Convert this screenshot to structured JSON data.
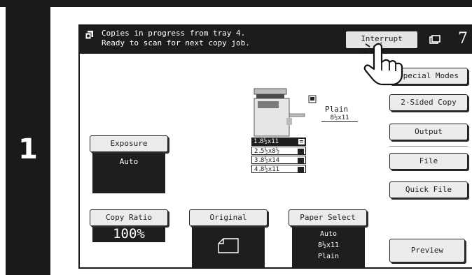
{
  "step": {
    "number": "1"
  },
  "status": {
    "line1": "Copies in progress from tray 4.",
    "line2": "Ready to scan for next copy job.",
    "icon": "copy-in-progress-icon"
  },
  "toolbar": {
    "interrupt_label": "Interrupt",
    "page_number": "7"
  },
  "side_buttons": {
    "special_modes": "Special Modes",
    "two_sided_copy": "2-Sided Copy",
    "output": "Output",
    "file": "File",
    "quick_file": "Quick File",
    "preview": "Preview"
  },
  "copier": {
    "output_paper_type": "Plain",
    "output_paper_size": "8½x11",
    "trays": [
      {
        "index": "1.",
        "size": "8½x11"
      },
      {
        "index": "2.",
        "size": "5½x8½"
      },
      {
        "index": "3.",
        "size": "8½x14"
      },
      {
        "index": "4.",
        "size": "8½x11"
      }
    ]
  },
  "exposure": {
    "label": "Exposure",
    "value": "Auto"
  },
  "copy_ratio": {
    "label": "Copy Ratio",
    "value": "100%"
  },
  "original": {
    "label": "Original",
    "icon": "original-paper-icon"
  },
  "paper_select": {
    "label": "Paper Select",
    "line1": "Auto",
    "line2": "8½x11",
    "line3": "Plain"
  }
}
